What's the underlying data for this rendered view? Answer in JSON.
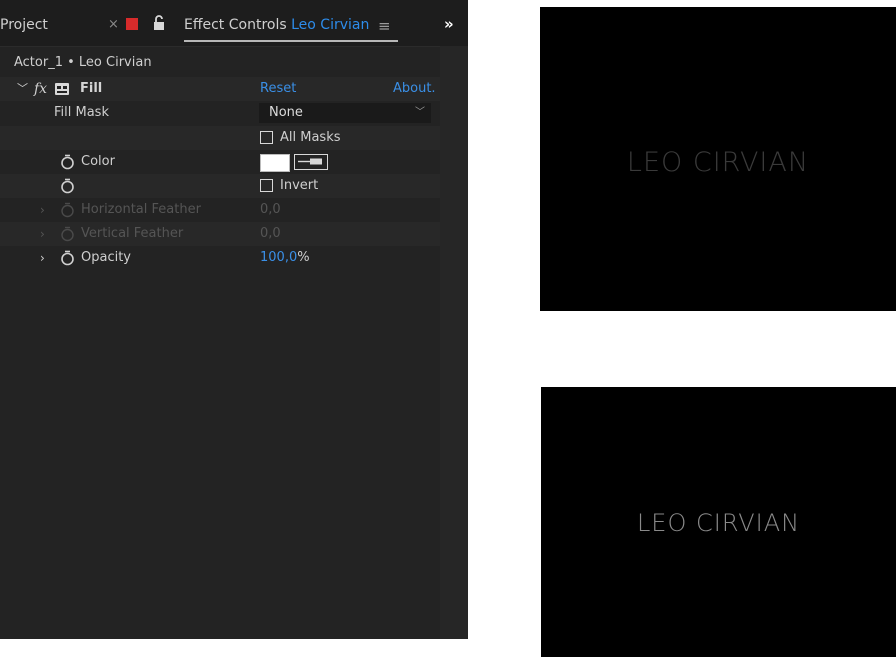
{
  "panel": {
    "tabs": {
      "project": "Project",
      "close": "×",
      "effect_prefix": "Effect Controls",
      "effect_selection": "Leo Cirvian",
      "menu": "≡",
      "more": "»"
    },
    "layer_title": "Actor_1 • Leo Cirvian",
    "effect": {
      "fx": "fx",
      "name": "Fill",
      "reset": "Reset",
      "about": "About."
    },
    "rows": {
      "fill_mask_label": "Fill Mask",
      "fill_mask_value": "None",
      "all_masks_label": "All Masks",
      "color_label": "Color",
      "color_value": "#ffffff",
      "invert_label": "Invert",
      "h_feather_label": "Horizontal Feather",
      "h_feather_value": "0,0",
      "v_feather_label": "Vertical Feather",
      "v_feather_value": "0,0",
      "opacity_label": "Opacity",
      "opacity_number": "100,0",
      "opacity_unit": "%"
    }
  },
  "previews": {
    "top": {
      "text": "LEO CIRVIAN",
      "text_color": "#3a3a3a"
    },
    "bottom": {
      "text": "LEO CIRVIAN",
      "text_color": "#8a8a8a"
    }
  }
}
